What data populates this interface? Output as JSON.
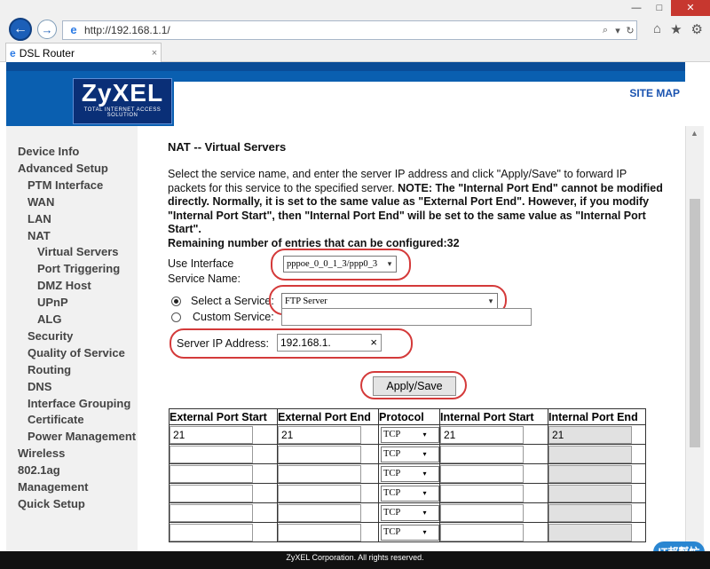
{
  "browser": {
    "url": "http://192.168.1.1/",
    "tab_title": "DSL Router",
    "back_glyph": "←",
    "forward_glyph": "→",
    "search_glyph": "⌕",
    "dropdown_glyph": "▾",
    "refresh_glyph": "↻",
    "home_glyph": "⌂",
    "favorites_glyph": "★",
    "settings_glyph": "⚙",
    "tab_close_glyph": "×",
    "ie_glyph": "e",
    "minimize_glyph": "—",
    "maximize_glyph": "□",
    "close_glyph": "✕"
  },
  "header": {
    "logo_text": "ZyXEL",
    "logo_tagline": "TOTAL INTERNET ACCESS SOLUTION",
    "site_map": "SITE MAP"
  },
  "sidebar": {
    "items": [
      {
        "label": "Device Info",
        "level": 0
      },
      {
        "label": "Advanced Setup",
        "level": 0
      },
      {
        "label": "PTM Interface",
        "level": 1
      },
      {
        "label": "WAN",
        "level": 1
      },
      {
        "label": "LAN",
        "level": 1
      },
      {
        "label": "NAT",
        "level": 1
      },
      {
        "label": "Virtual Servers",
        "level": 2
      },
      {
        "label": "Port Triggering",
        "level": 2
      },
      {
        "label": "DMZ Host",
        "level": 2
      },
      {
        "label": "UPnP",
        "level": 2
      },
      {
        "label": "ALG",
        "level": 2
      },
      {
        "label": "Security",
        "level": 1
      },
      {
        "label": "Quality of Service",
        "level": 1
      },
      {
        "label": "Routing",
        "level": 1
      },
      {
        "label": "DNS",
        "level": 1
      },
      {
        "label": "Interface Grouping",
        "level": 1
      },
      {
        "label": "Certificate",
        "level": 1
      },
      {
        "label": "Power Management",
        "level": 1
      },
      {
        "label": "Wireless",
        "level": 0
      },
      {
        "label": "802.1ag",
        "level": 0
      },
      {
        "label": "Management",
        "level": 0
      },
      {
        "label": "Quick Setup",
        "level": 0
      }
    ]
  },
  "main": {
    "title": "NAT -- Virtual Servers",
    "desc_plain": "Select the service name, and enter the server IP address and click \"Apply/Save\" to forward IP packets for this service to the specified server. ",
    "desc_bold": "NOTE: The \"Internal Port End\" cannot be modified directly. Normally, it is set to the same value as \"External Port End\". However, if you modify \"Internal Port Start\", then \"Internal Port End\" will be set to the same value as \"Internal Port Start\".",
    "remaining": "Remaining number of entries that can be configured:32",
    "use_interface_label": "Use Interface",
    "use_interface_value": "pppoe_0_0_1_3/ppp0_3",
    "service_name_label": "Service Name:",
    "select_service_label": "Select a Service:",
    "select_service_value": "FTP Server",
    "custom_service_label": "Custom Service:",
    "custom_service_value": "",
    "server_ip_label": "Server IP Address:",
    "server_ip_value": "192.168.1.",
    "clear_glyph": "×",
    "apply_label": "Apply/Save"
  },
  "table": {
    "headers": [
      "External Port Start",
      "External Port End",
      "Protocol",
      "Internal Port Start",
      "Internal Port End"
    ],
    "rows": [
      {
        "ext_start": "21",
        "ext_end": "21",
        "protocol": "TCP",
        "int_start": "21",
        "int_end": "21"
      },
      {
        "ext_start": "",
        "ext_end": "",
        "protocol": "TCP",
        "int_start": "",
        "int_end": ""
      },
      {
        "ext_start": "",
        "ext_end": "",
        "protocol": "TCP",
        "int_start": "",
        "int_end": ""
      },
      {
        "ext_start": "",
        "ext_end": "",
        "protocol": "TCP",
        "int_start": "",
        "int_end": ""
      },
      {
        "ext_start": "",
        "ext_end": "",
        "protocol": "TCP",
        "int_start": "",
        "int_end": ""
      },
      {
        "ext_start": "",
        "ext_end": "",
        "protocol": "TCP",
        "int_start": "",
        "int_end": ""
      }
    ]
  },
  "footer": {
    "copyright": "ZyXEL Corporation. All rights reserved."
  },
  "watermark": {
    "text": "IT邦幫忙"
  },
  "colors": {
    "header_blue": "#0a5fb0",
    "logo_navy": "#0a2f77",
    "highlight_red": "#d43a3a",
    "sidebar_bg": "#f1f1f1"
  }
}
